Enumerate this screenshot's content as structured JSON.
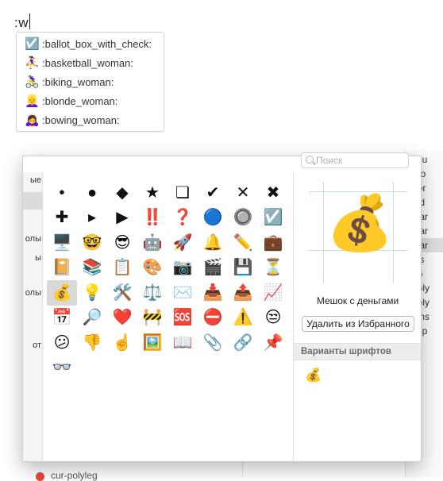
{
  "input": {
    "text": ":w"
  },
  "autocomplete": [
    {
      "emoji": "☑️",
      "label": ":ballot_box_with_check:"
    },
    {
      "emoji": "⛹️‍♀️",
      "label": ":basketball_woman:"
    },
    {
      "emoji": "🚴‍♀️",
      "label": ":biking_woman:"
    },
    {
      "emoji": "👱‍♀️",
      "label": ":blonde_woman:"
    },
    {
      "emoji": "🙇‍♀️",
      "label": ":bowing_woman:"
    }
  ],
  "background_files": [
    "_cu",
    "dro",
    "hor",
    "ind",
    "lear",
    "lear",
    "lear",
    "lps",
    "nb",
    "poly",
    "poly",
    "sms",
    "sup"
  ],
  "background_bottom_item": "cur-polyleg",
  "viewer": {
    "search_placeholder": "Поиск",
    "sidebar": [
      "ые",
      "",
      "олы",
      "ы",
      "олы",
      "",
      "от"
    ],
    "characters": [
      "•",
      "●",
      "◆",
      "★",
      "❏",
      "✔",
      "✕",
      "✖",
      "✚",
      "▸",
      "▶",
      "‼️",
      "❓",
      "🔵",
      "🔘",
      "☑️",
      "🖥️",
      "🤓",
      "😎",
      "🤖",
      "🚀",
      "🔔",
      "✏️",
      "💼",
      "📔",
      "📚",
      "📋",
      "🎨",
      "📷",
      "🎬",
      "💾",
      "⏳",
      "💰",
      "💡",
      "🛠️",
      "⚖️",
      "✉️",
      "📥",
      "📤",
      "📈",
      "📅",
      "🔎",
      "❤️",
      "🚧",
      "🆘",
      "⛔",
      "⚠️",
      "😒",
      "😕",
      "👎",
      "☝️",
      "🖼️",
      "📖",
      "📎",
      "🔗",
      "📌",
      "👓"
    ],
    "selected_char": "💰",
    "char_name": "Мешок с деньгами",
    "remove_favorite_label": "Удалить из Избранного",
    "variants_title": "Варианты шрифтов",
    "variants": [
      "💰"
    ]
  }
}
